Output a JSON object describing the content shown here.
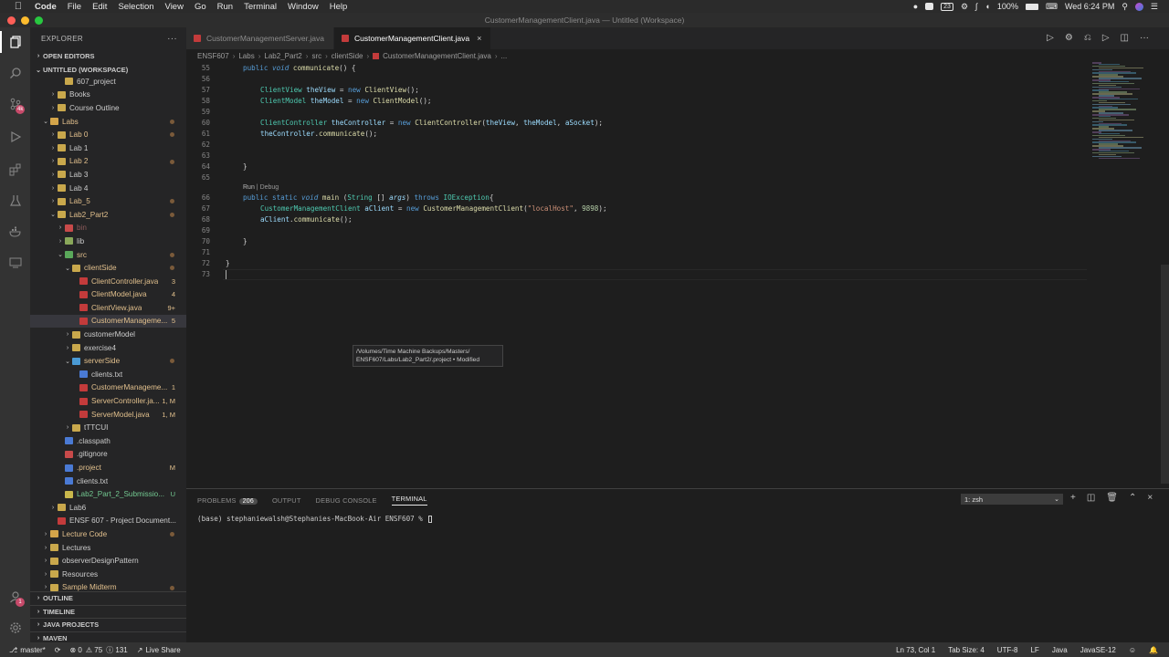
{
  "menubar": {
    "app": "Code",
    "items": [
      "File",
      "Edit",
      "Selection",
      "View",
      "Go",
      "Run",
      "Terminal",
      "Window",
      "Help"
    ],
    "status_icons": [
      "microphone-icon",
      "display-icon",
      "bluetooth-icon",
      "wifi-icon",
      "battery-icon"
    ],
    "date_badge": "23",
    "battery": "100%",
    "clock": "Wed 6:24 PM"
  },
  "window": {
    "title": "CustomerManagementClient.java — Untitled (Workspace)"
  },
  "activitybar": {
    "scm_badge": "4k",
    "accounts_badge": "1"
  },
  "sidebar": {
    "title": "EXPLORER",
    "more": "···",
    "open_editors": "OPEN EDITORS",
    "workspace": "UNTITLED (WORKSPACE)",
    "tree": [
      {
        "label": "607_project",
        "indent": 3,
        "chev": "",
        "icon": "#c9a84c",
        "deco": "",
        "color": "#cccccc"
      },
      {
        "label": "Books",
        "indent": 2,
        "chev": "›",
        "icon": "#c9a84c",
        "deco": "",
        "color": "#cccccc"
      },
      {
        "label": "Course Outline",
        "indent": 2,
        "chev": "›",
        "icon": "#c9a84c",
        "deco": "",
        "color": "#cccccc"
      },
      {
        "label": "Labs",
        "indent": 1,
        "chev": "⌄",
        "icon": "#d4a54a",
        "deco": "dot",
        "color": "#e2c08d"
      },
      {
        "label": "Lab 0",
        "indent": 2,
        "chev": "›",
        "icon": "#c9a84c",
        "deco": "dot",
        "color": "#e2c08d"
      },
      {
        "label": "Lab 1",
        "indent": 2,
        "chev": "›",
        "icon": "#c9a84c",
        "deco": "",
        "color": "#cccccc"
      },
      {
        "label": "Lab 2",
        "indent": 2,
        "chev": "›",
        "icon": "#c9a84c",
        "deco": "dot",
        "color": "#e2c08d"
      },
      {
        "label": "Lab 3",
        "indent": 2,
        "chev": "›",
        "icon": "#c9a84c",
        "deco": "",
        "color": "#cccccc"
      },
      {
        "label": "Lab 4",
        "indent": 2,
        "chev": "›",
        "icon": "#c9a84c",
        "deco": "",
        "color": "#cccccc"
      },
      {
        "label": "Lab_5",
        "indent": 2,
        "chev": "›",
        "icon": "#c9a84c",
        "deco": "dot",
        "color": "#e2c08d"
      },
      {
        "label": "Lab2_Part2",
        "indent": 2,
        "chev": "⌄",
        "icon": "#c9a84c",
        "deco": "dot",
        "color": "#e2c08d"
      },
      {
        "label": "bin",
        "indent": 3,
        "chev": "›",
        "icon": "#c84a4a",
        "deco": "",
        "color": "#8c5a5a"
      },
      {
        "label": "lib",
        "indent": 3,
        "chev": "›",
        "icon": "#8aa85a",
        "deco": "",
        "color": "#cccccc"
      },
      {
        "label": "src",
        "indent": 3,
        "chev": "⌄",
        "icon": "#5aa85a",
        "deco": "dot",
        "color": "#e2c08d"
      },
      {
        "label": "clientSide",
        "indent": 4,
        "chev": "⌄",
        "icon": "#c9a84c",
        "deco": "dot",
        "color": "#e2c08d"
      },
      {
        "label": "ClientController.java",
        "indent": 5,
        "chev": "",
        "icon": "#c33b3b",
        "deco": "3",
        "color": "#e2c08d"
      },
      {
        "label": "ClientModel.java",
        "indent": 5,
        "chev": "",
        "icon": "#c33b3b",
        "deco": "4",
        "color": "#e2c08d"
      },
      {
        "label": "ClientView.java",
        "indent": 5,
        "chev": "",
        "icon": "#c33b3b",
        "deco": "9+",
        "color": "#e2c08d"
      },
      {
        "label": "CustomerManageme...",
        "indent": 5,
        "chev": "",
        "icon": "#c33b3b",
        "deco": "5",
        "color": "#e2c08d",
        "selected": true
      },
      {
        "label": "customerModel",
        "indent": 4,
        "chev": "›",
        "icon": "#c9a84c",
        "deco": "",
        "color": "#cccccc"
      },
      {
        "label": "exercise4",
        "indent": 4,
        "chev": "›",
        "icon": "#c9a84c",
        "deco": "",
        "color": "#cccccc"
      },
      {
        "label": "serverSide",
        "indent": 4,
        "chev": "⌄",
        "icon": "#4a9ad4",
        "deco": "dot",
        "color": "#e2c08d"
      },
      {
        "label": "clients.txt",
        "indent": 5,
        "chev": "",
        "icon": "#4a7ad4",
        "deco": "",
        "color": "#cccccc"
      },
      {
        "label": "CustomerManageme...",
        "indent": 5,
        "chev": "",
        "icon": "#c33b3b",
        "deco": "1",
        "color": "#e2c08d"
      },
      {
        "label": "ServerController.ja...",
        "indent": 5,
        "chev": "",
        "icon": "#c33b3b",
        "deco": "1, M",
        "color": "#e2c08d"
      },
      {
        "label": "ServerModel.java",
        "indent": 5,
        "chev": "",
        "icon": "#c33b3b",
        "deco": "1, M",
        "color": "#e2c08d"
      },
      {
        "label": "tTTCUI",
        "indent": 4,
        "chev": "›",
        "icon": "#c9a84c",
        "deco": "",
        "color": "#cccccc"
      },
      {
        "label": ".classpath",
        "indent": 3,
        "chev": "",
        "icon": "#4a7ad4",
        "deco": "",
        "color": "#cccccc"
      },
      {
        "label": ".gitignore",
        "indent": 3,
        "chev": "",
        "icon": "#c84a4a",
        "deco": "",
        "color": "#cccccc"
      },
      {
        "label": ".project",
        "indent": 3,
        "chev": "",
        "icon": "#4a7ad4",
        "deco": "M",
        "color": "#e2c08d"
      },
      {
        "label": "clients.txt",
        "indent": 3,
        "chev": "",
        "icon": "#4a7ad4",
        "deco": "",
        "color": "#cccccc"
      },
      {
        "label": "Lab2_Part_2_Submissio...",
        "indent": 3,
        "chev": "",
        "icon": "#c9b84c",
        "deco": "U",
        "color": "#73c991"
      },
      {
        "label": "Lab6",
        "indent": 2,
        "chev": "›",
        "icon": "#c9a84c",
        "deco": "",
        "color": "#cccccc"
      },
      {
        "label": "ENSF 607 - Project Document...",
        "indent": 2,
        "chev": "",
        "icon": "#c33b3b",
        "deco": "",
        "color": "#cccccc"
      },
      {
        "label": "Lecture Code",
        "indent": 1,
        "chev": "›",
        "icon": "#d4a54a",
        "deco": "dot",
        "color": "#e2c08d"
      },
      {
        "label": "Lectures",
        "indent": 1,
        "chev": "›",
        "icon": "#c9a84c",
        "deco": "",
        "color": "#cccccc"
      },
      {
        "label": "observerDesignPattern",
        "indent": 1,
        "chev": "›",
        "icon": "#c9a84c",
        "deco": "",
        "color": "#cccccc"
      },
      {
        "label": "Resources",
        "indent": 1,
        "chev": "›",
        "icon": "#c9a84c",
        "deco": "",
        "color": "#cccccc"
      },
      {
        "label": "Sample Midterm",
        "indent": 1,
        "chev": "›",
        "icon": "#c9a84c",
        "deco": "dot",
        "color": "#e2c08d"
      }
    ],
    "bottom_sections": [
      "OUTLINE",
      "TIMELINE",
      "JAVA PROJECTS",
      "MAVEN"
    ]
  },
  "tabs": [
    {
      "label": "CustomerManagementServer.java",
      "active": false
    },
    {
      "label": "CustomerManagementClient.java",
      "active": true,
      "close": "×"
    }
  ],
  "breadcrumb": [
    "ENSF607",
    "Labs",
    "Lab2_Part2",
    "src",
    "clientSide",
    "CustomerManagementClient.java",
    "..."
  ],
  "codelens": {
    "run": "Run",
    "debug": "Debug"
  },
  "code": [
    {
      "n": "55",
      "i": 1,
      "tokens": [
        [
          "kw2",
          "public "
        ],
        [
          "kw2 it",
          "void "
        ],
        [
          "fn",
          "communicate"
        ],
        [
          "",
          "() {"
        ]
      ]
    },
    {
      "n": "56",
      "i": 0,
      "tokens": []
    },
    {
      "n": "57",
      "i": 2,
      "tokens": [
        [
          "ty",
          "ClientView "
        ],
        [
          "vr",
          "theView"
        ],
        [
          "",
          " = "
        ],
        [
          "kw2",
          "new "
        ],
        [
          "fn",
          "ClientView"
        ],
        [
          "",
          "();"
        ]
      ]
    },
    {
      "n": "58",
      "i": 2,
      "tokens": [
        [
          "ty",
          "ClientModel "
        ],
        [
          "vr",
          "theModel"
        ],
        [
          "",
          " = "
        ],
        [
          "kw2",
          "new "
        ],
        [
          "fn",
          "ClientModel"
        ],
        [
          "",
          "();"
        ]
      ]
    },
    {
      "n": "59",
      "i": 0,
      "tokens": []
    },
    {
      "n": "60",
      "i": 2,
      "tokens": [
        [
          "ty",
          "ClientController "
        ],
        [
          "vr",
          "theController"
        ],
        [
          "",
          " = "
        ],
        [
          "kw2",
          "new "
        ],
        [
          "fn",
          "ClientController"
        ],
        [
          "",
          "("
        ],
        [
          "vr",
          "theView"
        ],
        [
          "",
          ", "
        ],
        [
          "vr",
          "theModel"
        ],
        [
          "",
          ", "
        ],
        [
          "vr",
          "aSocket"
        ],
        [
          "",
          ");"
        ]
      ]
    },
    {
      "n": "61",
      "i": 2,
      "tokens": [
        [
          "vr",
          "theController"
        ],
        [
          "",
          "."
        ],
        [
          "fn",
          "communicate"
        ],
        [
          "",
          "();"
        ]
      ]
    },
    {
      "n": "62",
      "i": 0,
      "tokens": []
    },
    {
      "n": "63",
      "i": 0,
      "tokens": []
    },
    {
      "n": "64",
      "i": 1,
      "tokens": [
        [
          "",
          "}"
        ]
      ]
    },
    {
      "n": "65",
      "i": 0,
      "tokens": []
    },
    {
      "n": "66",
      "i": 1,
      "tokens": [
        [
          "kw2",
          "public "
        ],
        [
          "kw2",
          "static "
        ],
        [
          "kw2 it",
          "void "
        ],
        [
          "fn",
          "main "
        ],
        [
          "",
          "("
        ],
        [
          "ty",
          "String "
        ],
        [
          "",
          "[] "
        ],
        [
          "vr it",
          "args"
        ],
        [
          "",
          ") "
        ],
        [
          "kw2",
          "throws "
        ],
        [
          "ty",
          "IOException"
        ],
        [
          "",
          "{"
        ]
      ]
    },
    {
      "n": "67",
      "i": 2,
      "tokens": [
        [
          "ty",
          "CustomerManagementClient "
        ],
        [
          "vr",
          "aClient"
        ],
        [
          "",
          " = "
        ],
        [
          "kw2",
          "new "
        ],
        [
          "fn",
          "CustomerManagementClient"
        ],
        [
          "",
          "("
        ],
        [
          "str",
          "\"localHost\""
        ],
        [
          "",
          ", "
        ],
        [
          "num",
          "9898"
        ],
        [
          "",
          ");"
        ]
      ]
    },
    {
      "n": "68",
      "i": 2,
      "tokens": [
        [
          "vr",
          "aClient"
        ],
        [
          "",
          "."
        ],
        [
          "fn",
          "communicate"
        ],
        [
          "",
          "();"
        ]
      ]
    },
    {
      "n": "69",
      "i": 0,
      "tokens": []
    },
    {
      "n": "70",
      "i": 1,
      "tokens": [
        [
          "",
          "}"
        ]
      ]
    },
    {
      "n": "71",
      "i": 0,
      "tokens": []
    },
    {
      "n": "72",
      "i": 0,
      "tokens": [
        [
          "",
          "}"
        ]
      ]
    },
    {
      "n": "73",
      "i": 0,
      "tokens": []
    }
  ],
  "tooltip": {
    "line1": "/Volumes/Time Machine Backups/Masters/",
    "line2": "ENSF607/Labs/Lab2_Part2/.project • Modified"
  },
  "panel": {
    "tabs": [
      "PROBLEMS",
      "OUTPUT",
      "DEBUG CONSOLE",
      "TERMINAL"
    ],
    "problems_count": "206",
    "terminal_select": "1: zsh",
    "prompt": "(base) stephaniewalsh@Stephanies-MacBook-Air ENSF607 % "
  },
  "statusbar": {
    "branch": "master*",
    "sync": "⟳",
    "errors": "⊗ 0",
    "warnings": "⚠ 75",
    "info": "ⓘ 131",
    "liveshare": "Live Share",
    "position": "Ln 73, Col 1",
    "tabsize": "Tab Size: 4",
    "encoding": "UTF-8",
    "eol": "LF",
    "language": "Java",
    "jdk": "JavaSE-12"
  }
}
